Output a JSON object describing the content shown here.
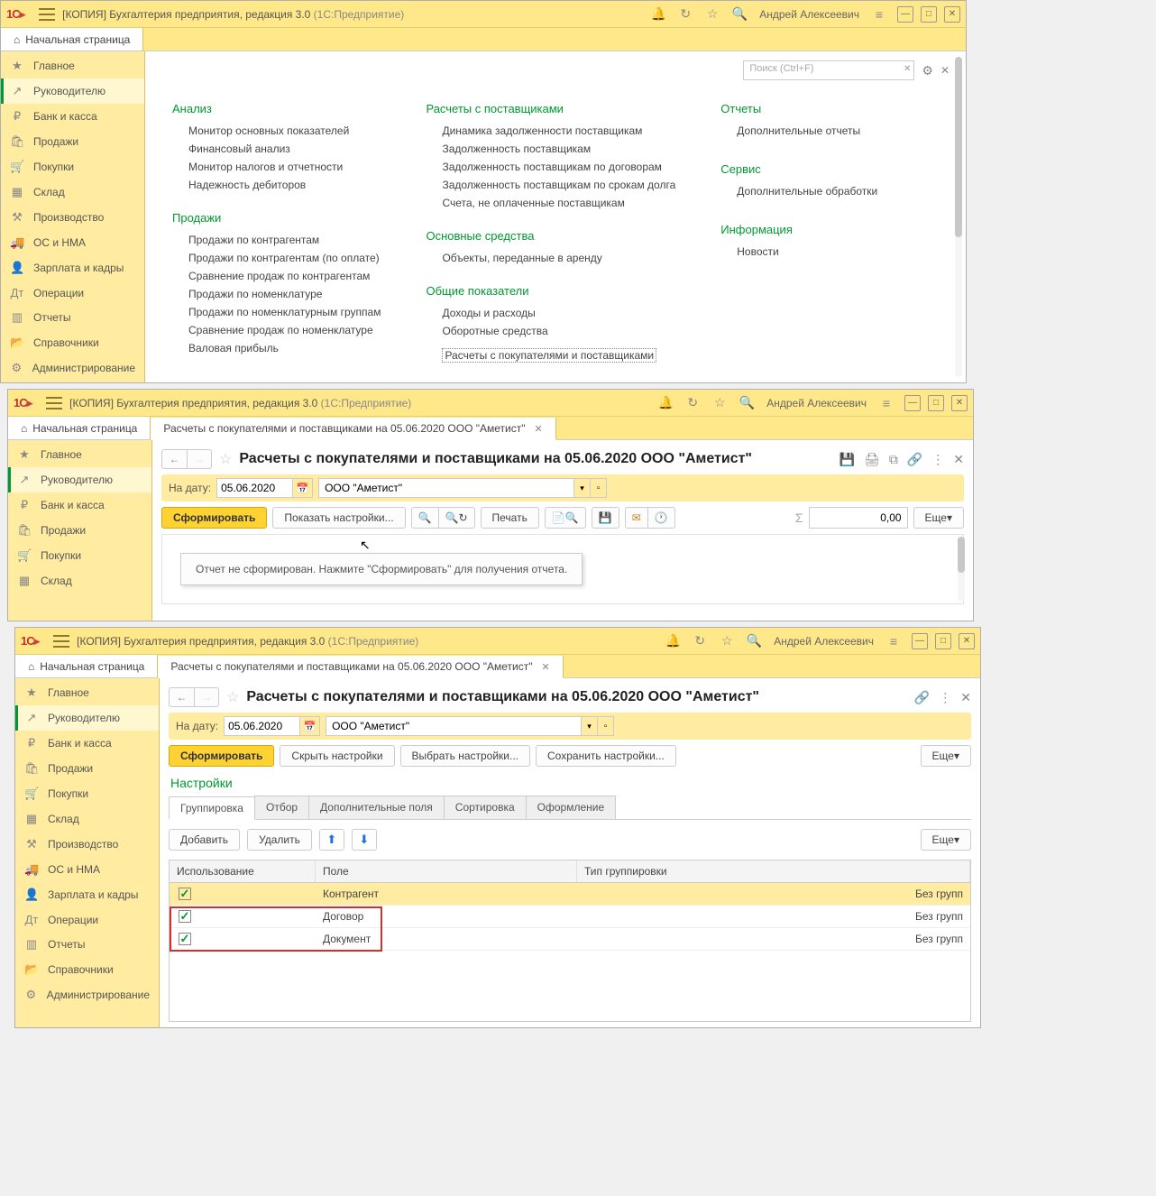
{
  "app": {
    "title_prefix": "[КОПИЯ] Бухгалтерия предприятия, редакция 3.0 ",
    "title_suffix": "(1С:Предприятие)",
    "username": "Андрей Алексеевич"
  },
  "tabs": {
    "home": "Начальная страница",
    "report": "Расчеты с покупателями и поставщиками на 05.06.2020 ООО \"Аметист\""
  },
  "sidebar": {
    "items": [
      {
        "label": "Главное",
        "icon": "★"
      },
      {
        "label": "Руководителю",
        "icon": "↗"
      },
      {
        "label": "Банк и касса",
        "icon": "₽"
      },
      {
        "label": "Продажи",
        "icon": "🛍"
      },
      {
        "label": "Покупки",
        "icon": "🛒"
      },
      {
        "label": "Склад",
        "icon": "▦"
      },
      {
        "label": "Производство",
        "icon": "⚒"
      },
      {
        "label": "ОС и НМА",
        "icon": "🚚"
      },
      {
        "label": "Зарплата и кадры",
        "icon": "👤"
      },
      {
        "label": "Операции",
        "icon": "Дт"
      },
      {
        "label": "Отчеты",
        "icon": "▥"
      },
      {
        "label": "Справочники",
        "icon": "📂"
      },
      {
        "label": "Администрирование",
        "icon": "⚙"
      }
    ]
  },
  "w1": {
    "search_placeholder": "Поиск (Ctrl+F)",
    "col1_h1": "Анализ",
    "col1_links1": [
      "Монитор основных показателей",
      "Финансовый анализ",
      "Монитор налогов и отчетности",
      "Надежность дебиторов"
    ],
    "col1_h2": "Продажи",
    "col1_links2": [
      "Продажи по контрагентам",
      "Продажи по контрагентам (по оплате)",
      "Сравнение продаж по контрагентам",
      "Продажи по номенклатуре",
      "Продажи по номенклатурным группам",
      "Сравнение продаж по номенклатуре",
      "Валовая прибыль"
    ],
    "col2_h1": "Расчеты с поставщиками",
    "col2_links1": [
      "Динамика задолженности поставщикам",
      "Задолженность поставщикам",
      "Задолженность поставщикам по договорам",
      "Задолженность поставщикам по срокам долга",
      "Счета, не оплаченные поставщикам"
    ],
    "col2_h2": "Основные средства",
    "col2_links2": [
      "Объекты, переданные в аренду"
    ],
    "col2_h3": "Общие показатели",
    "col2_links3": [
      "Доходы и расходы",
      "Оборотные средства"
    ],
    "col2_link_dotted": "Расчеты с покупателями и поставщиками",
    "col3_h1": "Отчеты",
    "col3_links1": [
      "Дополнительные отчеты"
    ],
    "col3_h2": "Сервис",
    "col3_links2": [
      "Дополнительные обработки"
    ],
    "col3_h3": "Информация",
    "col3_links3": [
      "Новости"
    ]
  },
  "w2": {
    "page_title": "Расчеты с покупателями и поставщиками на 05.06.2020 ООО \"Аметист\"",
    "date_label": "На дату:",
    "date_value": "05.06.2020",
    "org_value": "ООО \"Аметист\"",
    "btn_form": "Сформировать",
    "btn_show_settings": "Показать настройки...",
    "btn_print": "Печать",
    "sum_value": "0,00",
    "btn_more": "Еще",
    "hint": "Отчет не сформирован. Нажмите \"Сформировать\" для получения отчета."
  },
  "w3": {
    "page_title": "Расчеты с покупателями и поставщиками на 05.06.2020 ООО \"Аметист\"",
    "date_label": "На дату:",
    "date_value": "05.06.2020",
    "org_value": "ООО \"Аметист\"",
    "btn_form": "Сформировать",
    "btn_hide": "Скрыть настройки",
    "btn_choose": "Выбрать настройки...",
    "btn_save": "Сохранить настройки...",
    "btn_more": "Еще",
    "settings_title": "Настройки",
    "tabs": [
      "Группировка",
      "Отбор",
      "Дополнительные поля",
      "Сортировка",
      "Оформление"
    ],
    "btn_add": "Добавить",
    "btn_del": "Удалить",
    "grid_head": [
      "Использование",
      "Поле",
      "Тип группировки"
    ],
    "rows": [
      {
        "field": "Контрагент",
        "type": "Без групп"
      },
      {
        "field": "Договор",
        "type": "Без групп"
      },
      {
        "field": "Документ",
        "type": "Без групп"
      }
    ]
  }
}
